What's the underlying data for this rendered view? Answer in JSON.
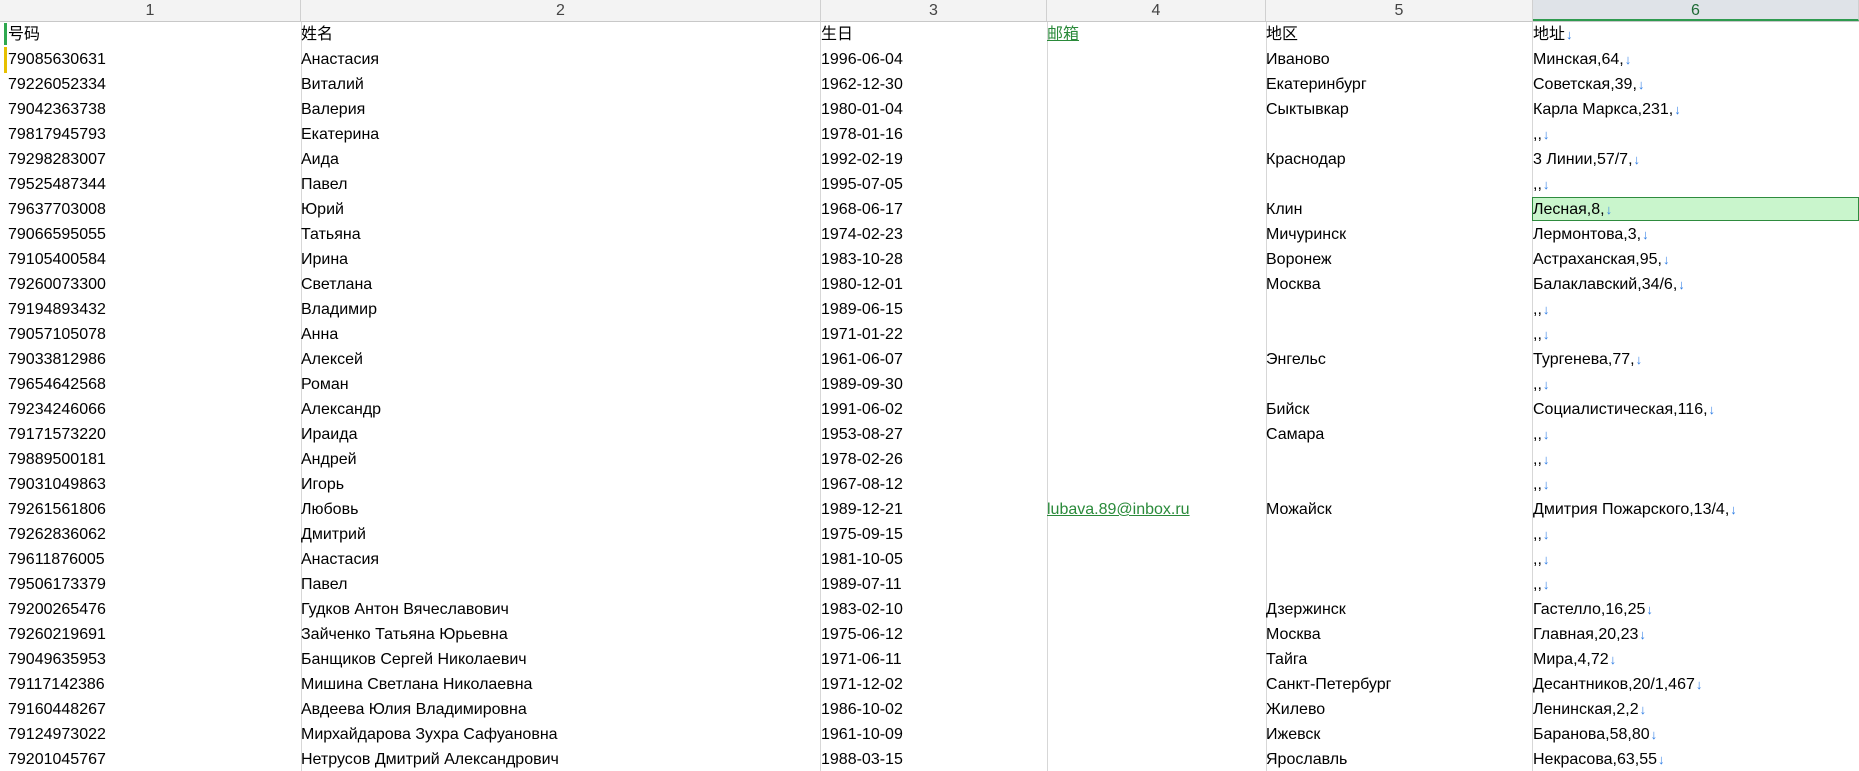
{
  "columns": [
    "1",
    "2",
    "3",
    "4",
    "5",
    "6"
  ],
  "active_column": "6",
  "colors": {
    "email_link": "#2a8a3a",
    "selection": "#c9f5cc",
    "arrow": "#2f7ee6"
  },
  "rows": [
    [
      "号码",
      "姓名",
      "生日",
      "邮箱",
      "地区",
      "地址"
    ],
    [
      "79085630631",
      "Анастасия",
      "1996-06-04",
      "",
      "Иваново",
      "Минская,64,"
    ],
    [
      "79226052334",
      "Виталий",
      "1962-12-30",
      "",
      "Екатеринбург",
      "Советская,39,"
    ],
    [
      "79042363738",
      "Валерия",
      "1980-01-04",
      "",
      "Сыктывкар",
      "Карла Маркса,231,"
    ],
    [
      "79817945793",
      "Екатерина",
      "1978-01-16",
      "",
      "",
      ",,"
    ],
    [
      "79298283007",
      "Аида",
      "1992-02-19",
      "",
      "Краснодар",
      "3 Линии,57/7,"
    ],
    [
      "79525487344",
      "Павел",
      "1995-07-05",
      "",
      "",
      ",,"
    ],
    [
      "79637703008",
      "Юрий",
      "1968-06-17",
      "",
      "Клин",
      "Лесная,8,"
    ],
    [
      "79066595055",
      "Татьяна",
      "1974-02-23",
      "",
      "Мичуринск",
      "Лермонтова,3,"
    ],
    [
      "79105400584",
      "Ирина",
      "1983-10-28",
      "",
      "Воронеж",
      "Астраханская,95,"
    ],
    [
      "79260073300",
      "Светлана",
      "1980-12-01",
      "",
      "Москва",
      "Балаклавский,34/6,"
    ],
    [
      "79194893432",
      "Владимир",
      "1989-06-15",
      "",
      "",
      ",,"
    ],
    [
      "79057105078",
      "Анна",
      "1971-01-22",
      "",
      "",
      ",,"
    ],
    [
      "79033812986",
      "Алексей",
      "1961-06-07",
      "",
      "Энгельс",
      "Тургенева,77,"
    ],
    [
      "79654642568",
      "Роман",
      "1989-09-30",
      "",
      "",
      ",,"
    ],
    [
      "79234246066",
      "Александр",
      "1991-06-02",
      "",
      "Бийск",
      "Социалистическая,116,"
    ],
    [
      "79171573220",
      "Ираида",
      "1953-08-27",
      "",
      "Самара",
      ",,"
    ],
    [
      "79889500181",
      "Андрей",
      "1978-02-26",
      "",
      "",
      ",,"
    ],
    [
      "79031049863",
      "Игорь",
      "1967-08-12",
      "",
      "",
      ",,"
    ],
    [
      "79261561806",
      "Любовь",
      "1989-12-21",
      "lubava.89@inbox.ru",
      "Можайск",
      "Дмитрия Пожарского,13/4,"
    ],
    [
      "79262836062",
      "Дмитрий",
      "1975-09-15",
      "",
      "",
      ",,"
    ],
    [
      "79611876005",
      "Анастасия",
      "1981-10-05",
      "",
      "",
      ",,"
    ],
    [
      "79506173379",
      "Павел",
      "1989-07-11",
      "",
      "",
      ",,"
    ],
    [
      "79200265476",
      "Гудков Антон Вячеславович",
      "1983-02-10",
      "",
      "Дзержинск",
      "Гастелло,16,25"
    ],
    [
      "79260219691",
      "Зайченко Татьяна Юрьевна",
      "1975-06-12",
      "",
      "Москва",
      "Главная,20,23"
    ],
    [
      "79049635953",
      "Банщиков Сергей Николаевич",
      "1971-06-11",
      "",
      "Тайга",
      "Мира,4,72"
    ],
    [
      "79117142386",
      "Мишина Светлана Николаевна",
      "1971-12-02",
      "",
      "Санкт-Петербург",
      "Десантников,20/1,467"
    ],
    [
      "79160448267",
      "Авдеева Юлия Владимировна",
      "1986-10-02",
      "",
      "Жилево",
      "Ленинская,2,2"
    ],
    [
      "79124973022",
      "Мирхайдарова Зухра Сафуановна",
      "1961-10-09",
      "",
      "Ижевск",
      "Баранова,58,80"
    ],
    [
      "79201045767",
      "Нетрусов Дмитрий Александрович",
      "1988-03-15",
      "",
      "Ярославль",
      "Некрасова,63,55"
    ]
  ]
}
